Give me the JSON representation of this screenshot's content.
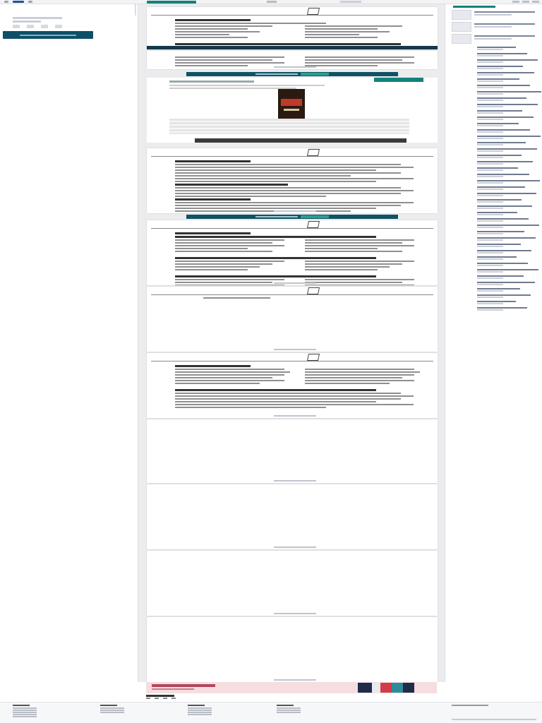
{
  "topbar": {
    "menu_icon": "menu-icon",
    "back_label": "",
    "page_indicator": "",
    "zoom_label": "",
    "actions": [
      "",
      "",
      ""
    ]
  },
  "document": {
    "title": "",
    "author": "",
    "uploaded": "",
    "stats": [
      "",
      "",
      "",
      ""
    ],
    "download_label": ""
  },
  "pages": [
    {
      "module_word": "",
      "module_num": ""
    },
    {
      "module_word": "",
      "module_num": ""
    },
    {
      "module_word": "",
      "module_num": ""
    },
    {
      "module_word": "",
      "module_num": ""
    },
    {
      "module_word": "",
      "module_num": ""
    }
  ],
  "banner": {
    "text": "",
    "cta": ""
  },
  "ad": {
    "label": "",
    "title": "",
    "subtitle": ""
  },
  "sidebar": {
    "heading": "",
    "items": [
      "",
      "",
      "",
      "",
      "",
      "",
      "",
      "",
      "",
      "",
      "",
      "",
      "",
      "",
      "",
      "",
      "",
      "",
      "",
      "",
      "",
      "",
      "",
      "",
      "",
      "",
      "",
      "",
      "",
      "",
      "",
      "",
      "",
      "",
      "",
      "",
      "",
      "",
      "",
      "",
      "",
      ""
    ]
  },
  "promo": {
    "title": "",
    "subtitle": ""
  },
  "share": {
    "label": ""
  },
  "footer": {
    "columns": [
      "",
      "",
      "",
      ""
    ],
    "app_label": "",
    "copyright": ""
  }
}
